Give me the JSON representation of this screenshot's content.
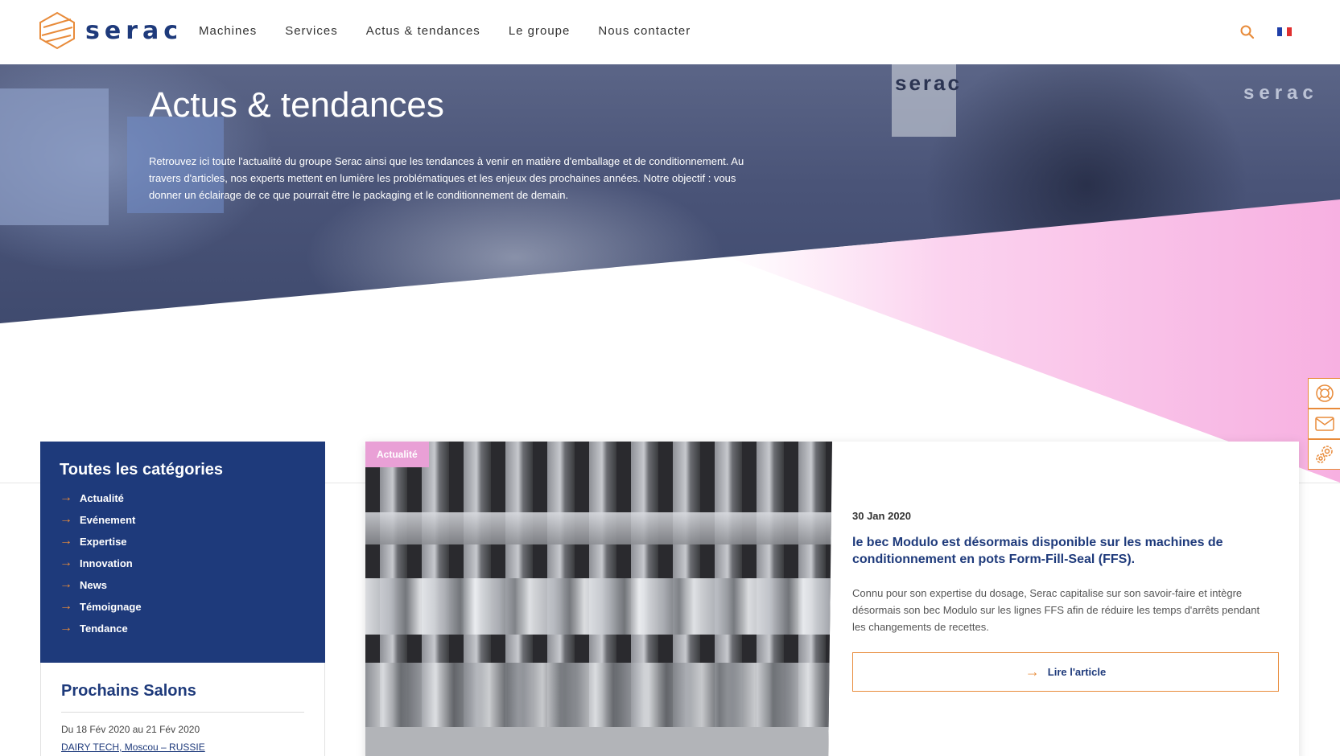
{
  "header": {
    "logo_text": "serac",
    "nav": [
      {
        "label": "Machines"
      },
      {
        "label": "Services"
      },
      {
        "label": "Actus & tendances"
      },
      {
        "label": "Le groupe"
      },
      {
        "label": "Nous contacter"
      }
    ]
  },
  "hero": {
    "title": "Actus & tendances",
    "text": "Retrouvez ici toute l'actualité du groupe Serac ainsi que les tendances à venir en matière d'emballage et de conditionnement. Au travers d'articles, nos experts mettent en lumière les problématiques et les enjeux des prochaines années. Notre objectif : vous donner un éclairage de ce que pourrait être le packaging et le conditionnement de demain.",
    "photo_brand_1": "serac",
    "photo_brand_2": "serac"
  },
  "categories": {
    "title": "Toutes les catégories",
    "items": [
      {
        "label": "Actualité"
      },
      {
        "label": "Evénement"
      },
      {
        "label": "Expertise"
      },
      {
        "label": "Innovation"
      },
      {
        "label": "News"
      },
      {
        "label": "Témoignage"
      },
      {
        "label": "Tendance"
      }
    ]
  },
  "salons": {
    "title": "Prochains Salons",
    "date": "Du 18 Fév 2020 au 21 Fév 2020",
    "event": "DAIRY TECH, Moscou – RUSSIE"
  },
  "article": {
    "badge": "Actualité",
    "date": "30 Jan 2020",
    "title": "le bec Modulo est désormais disponible sur les machines de conditionnement en pots Form-Fill-Seal (FFS).",
    "text": "Connu pour son expertise du dosage, Serac capitalise sur son savoir-faire et intègre désormais son bec Modulo sur les lignes FFS afin de réduire les temps d'arrêts pendant les changements de recettes.",
    "button_label": "Lire l'article"
  },
  "icons": {
    "search": "search-icon",
    "flag": "french-flag-icon",
    "support": "lifebuoy-icon",
    "mail": "mail-icon",
    "settings": "gears-icon",
    "arrow": "arrow-right-icon"
  },
  "colors": {
    "brand_blue": "#1e3a7b",
    "accent_orange": "#e88b3a",
    "pink": "#f7b6e4",
    "badge_pink": "#e9a0d6"
  }
}
